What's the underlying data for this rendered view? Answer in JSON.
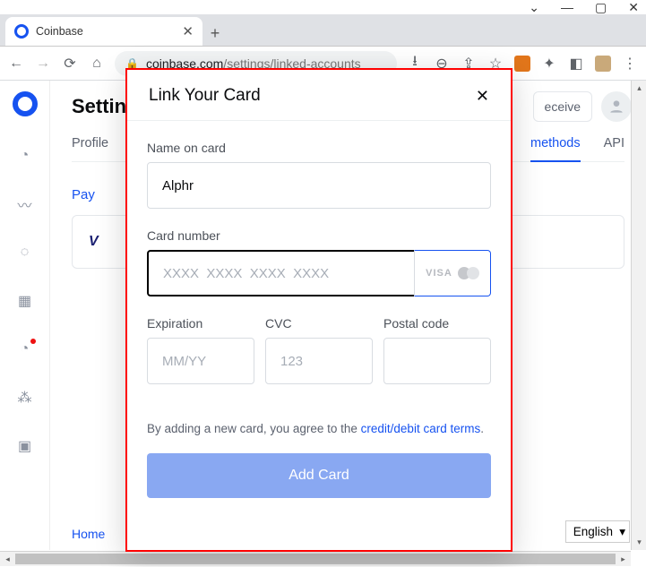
{
  "window": {
    "tab_title": "Coinbase",
    "url_domain": "coinbase.com",
    "url_path": "/settings/linked-accounts"
  },
  "page": {
    "heading": "Settings",
    "tabs": {
      "profile": "Profile",
      "methods": "methods",
      "api": "API"
    },
    "pay_label": "Pay",
    "receive_btn": "eceive",
    "footer_home": "Home",
    "lang": "English"
  },
  "modal": {
    "title": "Link Your Card",
    "name_label": "Name on card",
    "name_value": "Alphr",
    "cardnum_label": "Card number",
    "cardnum_placeholder": "XXXX  XXXX  XXXX  XXXX",
    "visa": "VISA",
    "exp_label": "Expiration",
    "exp_placeholder": "MM/YY",
    "cvc_label": "CVC",
    "cvc_placeholder": "123",
    "postal_label": "Postal code",
    "terms_prefix": "By adding a new card, you agree to the ",
    "terms_link": "credit/debit card terms",
    "terms_suffix": ".",
    "submit": "Add Card"
  }
}
